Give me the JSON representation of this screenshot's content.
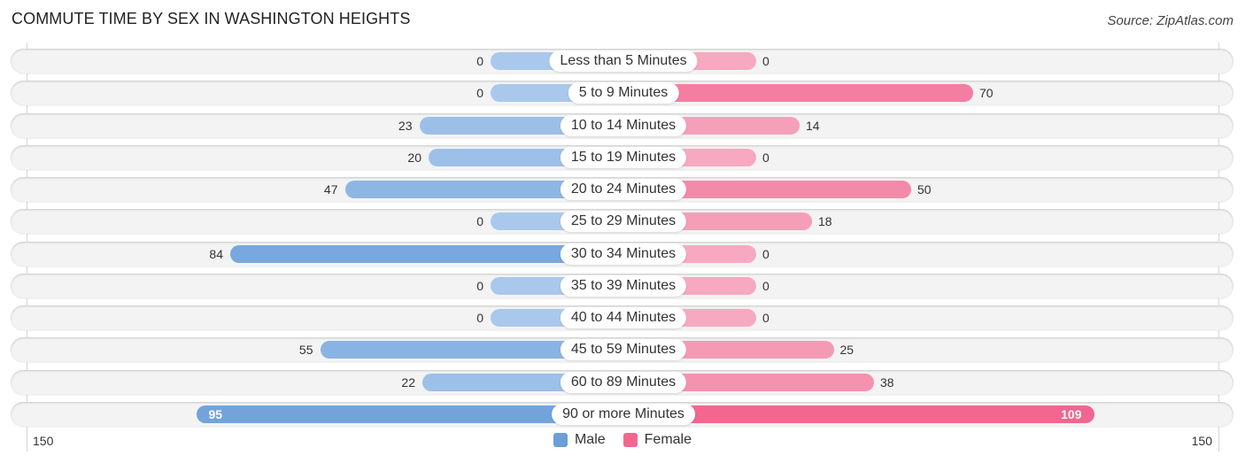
{
  "header": {
    "title": "COMMUTE TIME BY SEX IN WASHINGTON HEIGHTS",
    "source": "Source: ZipAtlas.com"
  },
  "colors": {
    "male_strong": "#6a9fd8",
    "male_light": "#a9c8ec",
    "female_strong": "#f2668f",
    "female_light": "#f6a9c0",
    "track": "#f3f3f3"
  },
  "chart_data": {
    "type": "bar",
    "orientation": "horizontal-diverging",
    "title": "COMMUTE TIME BY SEX IN WASHINGTON HEIGHTS",
    "categories": [
      "Less than 5 Minutes",
      "5 to 9 Minutes",
      "10 to 14 Minutes",
      "15 to 19 Minutes",
      "20 to 24 Minutes",
      "25 to 29 Minutes",
      "30 to 34 Minutes",
      "35 to 39 Minutes",
      "40 to 44 Minutes",
      "45 to 59 Minutes",
      "60 to 89 Minutes",
      "90 or more Minutes"
    ],
    "series": [
      {
        "name": "Male",
        "values": [
          0,
          0,
          23,
          20,
          47,
          0,
          84,
          0,
          0,
          55,
          22,
          95
        ]
      },
      {
        "name": "Female",
        "values": [
          0,
          70,
          14,
          0,
          50,
          18,
          0,
          0,
          0,
          25,
          38,
          109
        ]
      }
    ],
    "axis": {
      "left_label": "150",
      "right_label": "150",
      "range": [
        -150,
        150
      ]
    },
    "legend": {
      "position": "bottom-center",
      "entries": [
        "Male",
        "Female"
      ]
    },
    "grid": false
  }
}
